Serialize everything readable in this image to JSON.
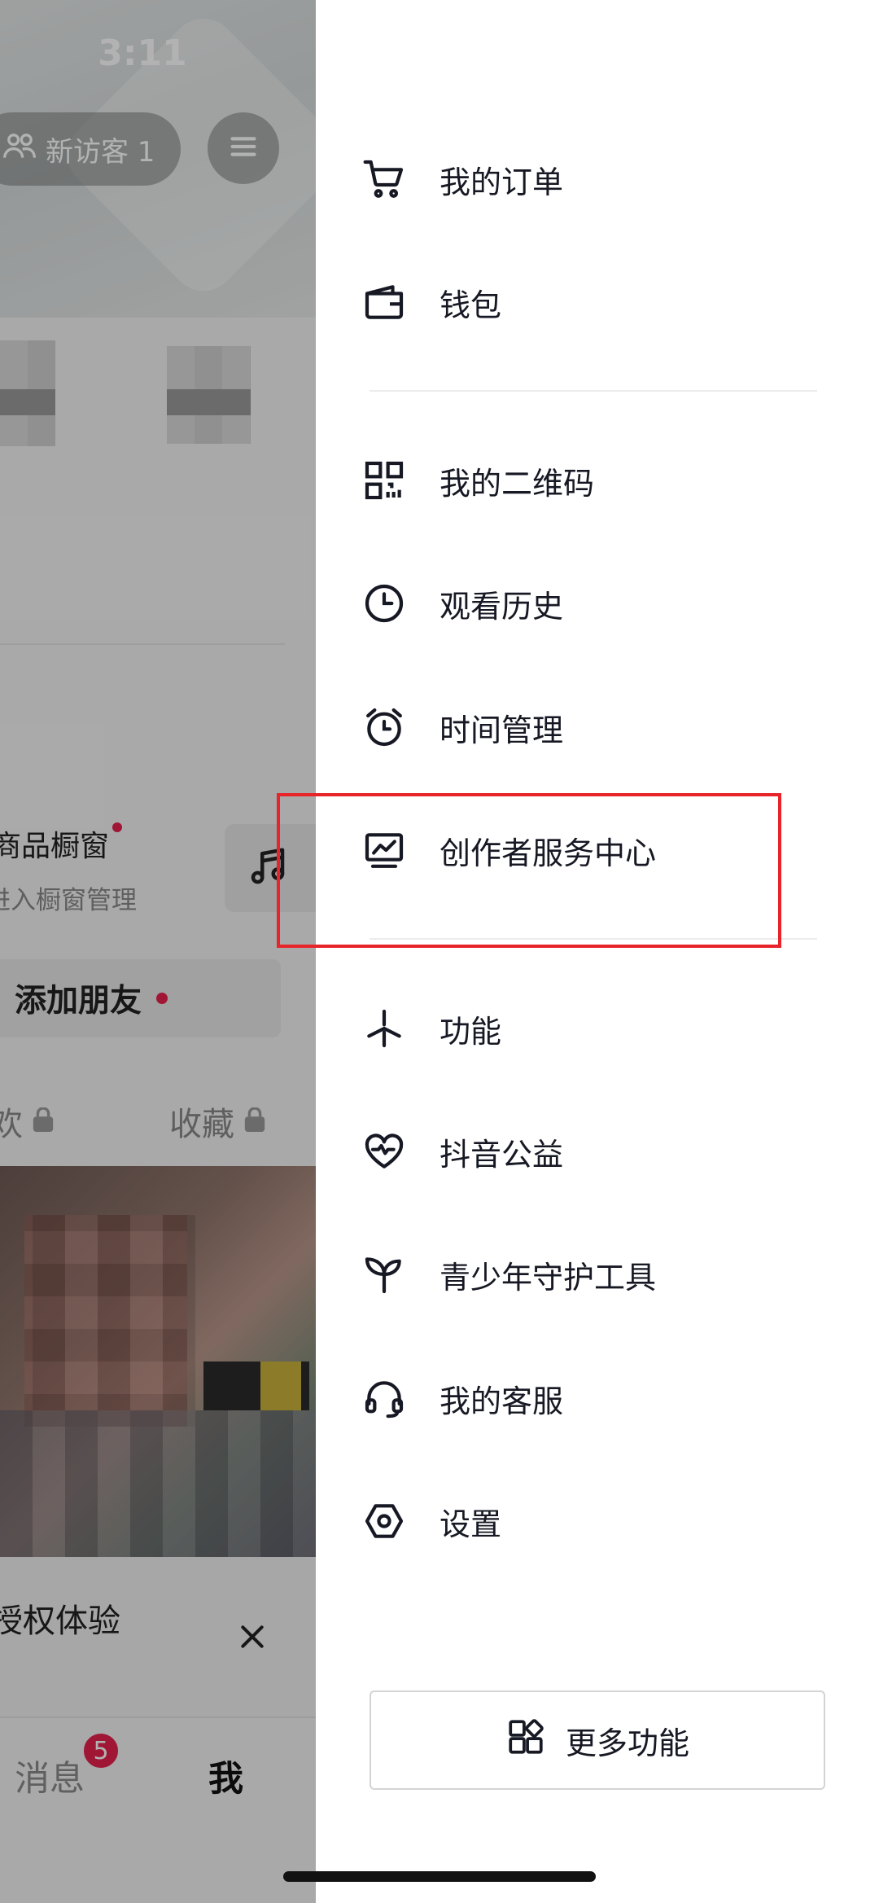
{
  "status_bar": {
    "time": "3:11"
  },
  "profile": {
    "visitor_label": "新访客 1",
    "shop_window_title": "商品橱窗",
    "shop_window_sub": "进入橱窗管理",
    "add_friend": "添加朋友",
    "tab_likes": "欢",
    "tab_favorites": "收藏",
    "banner_text": "授权体验",
    "tabbar": {
      "messages": "消息",
      "messages_badge": "5",
      "me": "我"
    }
  },
  "drawer": {
    "section1": [
      {
        "label": "我的订单",
        "icon": "cart-icon"
      },
      {
        "label": "钱包",
        "icon": "wallet-icon"
      }
    ],
    "section2": [
      {
        "label": "我的二维码",
        "icon": "qrcode-icon"
      },
      {
        "label": "观看历史",
        "icon": "clock-icon"
      },
      {
        "label": "时间管理",
        "icon": "alarm-icon"
      },
      {
        "label": "创作者服务中心",
        "icon": "creator-chart-icon"
      }
    ],
    "section3": [
      {
        "label": "功能",
        "icon": "sparkle-icon"
      },
      {
        "label": "抖音公益",
        "icon": "heart-charity-icon"
      },
      {
        "label": "青少年守护工具",
        "icon": "sprout-icon"
      },
      {
        "label": "我的客服",
        "icon": "headset-icon"
      },
      {
        "label": "设置",
        "icon": "hexagon-settings-icon"
      }
    ],
    "more_button": "更多功能"
  },
  "colors": {
    "accent_red": "#e5204d",
    "highlight_box": "#e8232a",
    "text": "#161823"
  }
}
